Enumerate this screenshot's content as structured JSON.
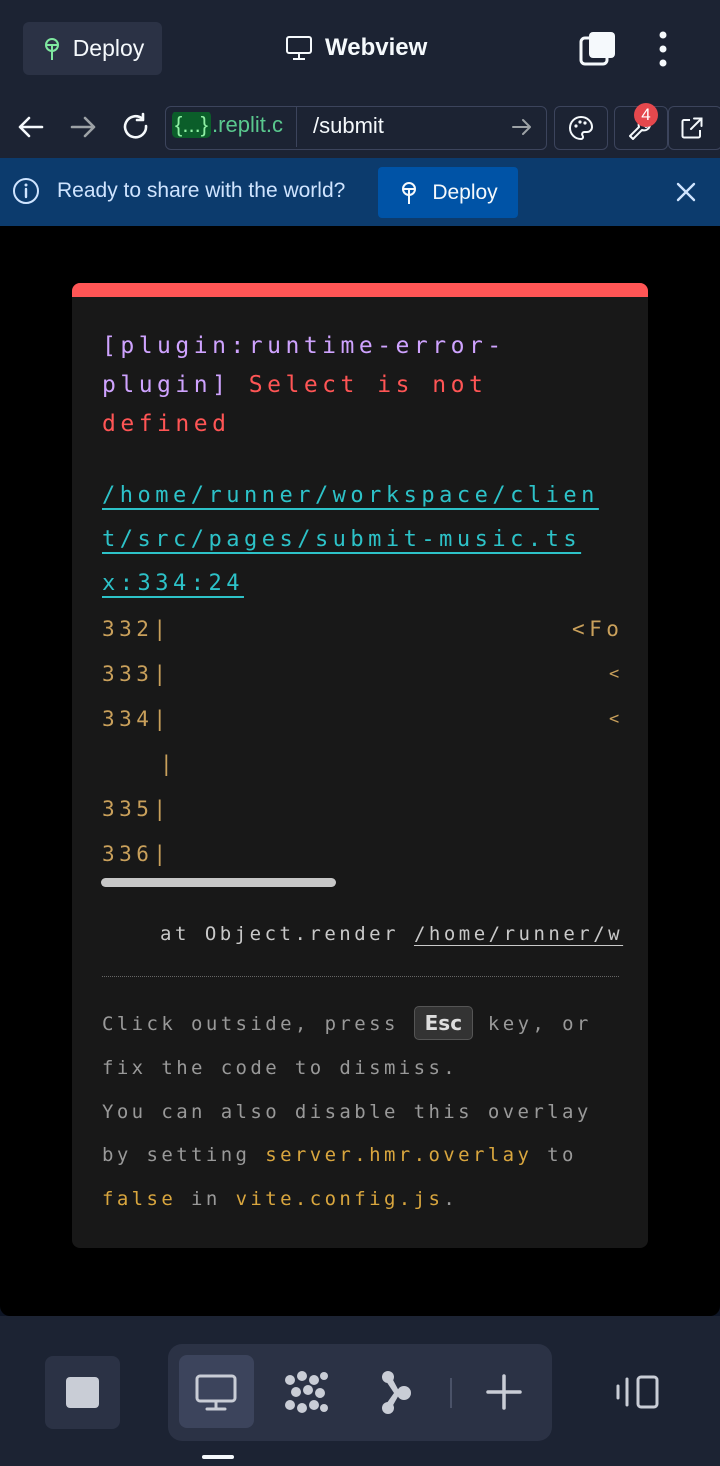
{
  "header": {
    "deploy_label": "Deploy",
    "title": "Webview"
  },
  "navbar": {
    "url_host_tag": "{...}",
    "url_host": ".replit.c",
    "url_path": "/submit",
    "badge_count": "4"
  },
  "banner": {
    "message": "Ready to share with the world?",
    "deploy_label": "Deploy"
  },
  "error_overlay": {
    "plugin_line1": "[plugin:runtime-error-",
    "plugin_line2": "plugin]",
    "error_msg1": "Select is not",
    "error_msg2": "defined",
    "file_link": [
      "/home/runner/workspace/clien",
      "t/src/pages/submit-music.ts",
      "x:334:24"
    ],
    "code_lines": [
      {
        "num": "332|",
        "code": "<Fo"
      },
      {
        "num": "333|",
        "code": "<"
      },
      {
        "num": "334|",
        "code": "<"
      },
      {
        "num": "|",
        "code": ""
      },
      {
        "num": "335|",
        "code": ""
      },
      {
        "num": "336|",
        "code": ""
      }
    ],
    "stack_prefix": "at Object.render ",
    "stack_path": "/home/runner/w",
    "tip": {
      "t1": "Click outside, press ",
      "key": "Esc",
      "t2": " key, or",
      "t3": "fix the code to dismiss.",
      "t4": "You can also disable this overlay",
      "t5": "by setting ",
      "code1": "server.hmr.overlay",
      "t6": " to",
      "code2": "false",
      "t7": " in ",
      "code3": "vite.config.js",
      "t8": "."
    }
  },
  "colors": {
    "accent_error": "#ff5555",
    "banner_bg": "#0c3b6d",
    "deploy_button": "#0053a6"
  }
}
